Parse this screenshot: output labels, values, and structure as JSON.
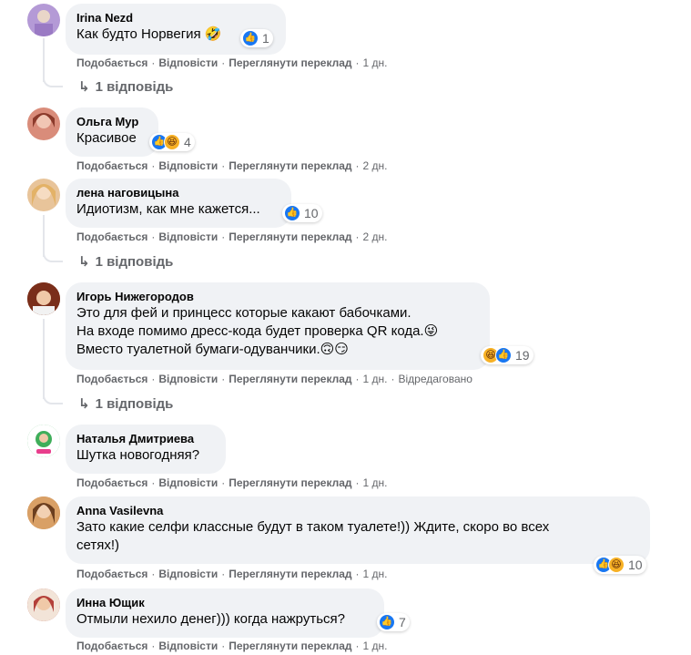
{
  "actions": {
    "like": "Подобається",
    "reply": "Відповісти",
    "translate": "Переглянути переклад",
    "sep": "·"
  },
  "comments": [
    {
      "author": "Irina Nezd",
      "text": "Как будто Норвегия",
      "emoji": "🤣",
      "reactions": {
        "count": "1"
      },
      "time": "1 дн.",
      "replies": "1 відповідь",
      "avatar_color": "#b49ad6"
    },
    {
      "author": "Ольга Мур",
      "text": "Красивое",
      "reactions": {
        "count": "4"
      },
      "time": "2 дн.",
      "avatar_color": "#d98c7a"
    },
    {
      "author": "лена наговицына",
      "text": "Идиотизм, как мне кажется...",
      "reactions": {
        "count": "10"
      },
      "time": "2 дн.",
      "replies": "1 відповідь",
      "avatar_color": "#e8c49a"
    },
    {
      "author": "Игорь Нижегородов",
      "lines": [
        "Это для фей и принцесс которые какают бабочками.",
        "На входе помимо дресс-кода будет проверка QR кода.",
        "Вместо туалетной бумаги-одуванчики."
      ],
      "line2_emoji": "😜",
      "line3_emoji": "🙃😏",
      "reactions": {
        "count": "19"
      },
      "time": "1 дн.",
      "edited": "Відредаговано",
      "replies": "1 відповідь",
      "avatar_color": "#a0522d"
    },
    {
      "author": "Наталья Дмитриева",
      "text": "Шутка новогодняя?",
      "time": "1 дн.",
      "avatar_color": "#3fae5a"
    },
    {
      "author": "Anna Vasilevna",
      "lines": [
        "Зато какие селфи классные будут в таком туалете!)) Ждите, скоро во всех",
        "сетях!)"
      ],
      "reactions": {
        "count": "10"
      },
      "time": "1 дн.",
      "avatar_color": "#c98a4b"
    },
    {
      "author": "Инна Ющик",
      "text": "Отмыли нехило денег))) когда нажруться?",
      "reactions": {
        "count": "7"
      },
      "time": "1 дн.",
      "avatar_color": "#b3403a"
    }
  ]
}
